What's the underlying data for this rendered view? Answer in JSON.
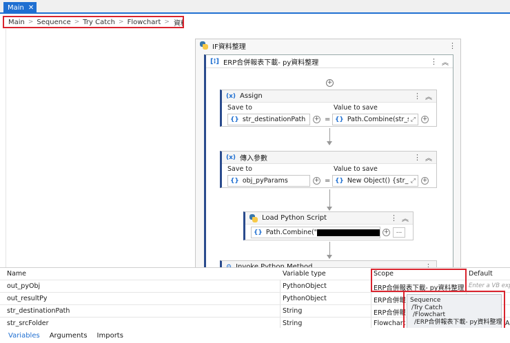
{
  "tabs": [
    {
      "label": "Main",
      "close": "✕"
    }
  ],
  "breadcrumb": [
    "Main",
    "Sequence",
    "Try Catch",
    "Flowchart",
    "資料整理"
  ],
  "if_block": {
    "title": "IF資料整理"
  },
  "sequence": {
    "title": "ERP合併報表下載- py資料整理"
  },
  "assign": {
    "title": "Assign",
    "save_to_label": "Save to",
    "value_label": "Value to save",
    "save_to": "str_destinationPath",
    "value": "Path.Combine(str_src"
  },
  "param": {
    "title": "傳入參數",
    "save_to_label": "Save to",
    "value_label": "Value to save",
    "save_to": "obj_pyParams",
    "value": "New Object() {str_des"
  },
  "load_script": {
    "title": "Load Python Script",
    "value": "Path.Combine(\""
  },
  "invoke": {
    "title": "Invoke Python Method"
  },
  "variables": {
    "headers": [
      "Name",
      "Variable type",
      "Scope",
      "Default"
    ],
    "rows": [
      {
        "name": "out_pyObj",
        "type": "PythonObject",
        "scope": "ERP合併報表下載- py資料整理",
        "default": "Enter a VB expr"
      },
      {
        "name": "out_resultPy",
        "type": "PythonObject",
        "scope": "ERP合併報",
        "default": ""
      },
      {
        "name": "str_destinationPath",
        "type": "String",
        "scope": "ERP合併報",
        "default": ""
      },
      {
        "name": "str_srcFolder",
        "type": "String",
        "scope": "Flowchart",
        "default": "A"
      }
    ]
  },
  "tooltip": {
    "lines": [
      "Sequence",
      "/Try Catch",
      "/Flowchart",
      "/ERP合併報表下載- py資料整理"
    ]
  },
  "bottom_tabs": [
    "Variables",
    "Arguments",
    "Imports"
  ],
  "colors": {
    "accent": "#1f6fd1",
    "highlight": "#d9232d",
    "activity_bar": "#2a4b8d"
  }
}
